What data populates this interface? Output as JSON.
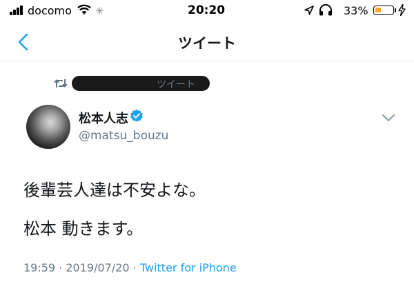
{
  "status_bar": {
    "carrier": "docomo",
    "time": "20:20",
    "battery_percent": "33%",
    "battery_level": 0.33,
    "battery_color": "#f5a623"
  },
  "nav": {
    "back_icon": "chevron-left-icon",
    "title": "ツイート"
  },
  "context": {
    "icon": "retweet-icon",
    "label": "ツイート"
  },
  "author": {
    "name": "松本人志",
    "handle": "@matsu_bouzu",
    "verified_icon": "verified-badge-icon"
  },
  "tweet": {
    "lines": [
      "後輩芸人達は不安よな。",
      "松本 動きます。"
    ],
    "time": "19:59",
    "separator1": " · ",
    "date": "2019/07/20",
    "separator2": " · ",
    "source": "Twitter for iPhone"
  },
  "colors": {
    "accent": "#1da1f2",
    "secondary_text": "#657786",
    "primary_text": "#14171a"
  }
}
